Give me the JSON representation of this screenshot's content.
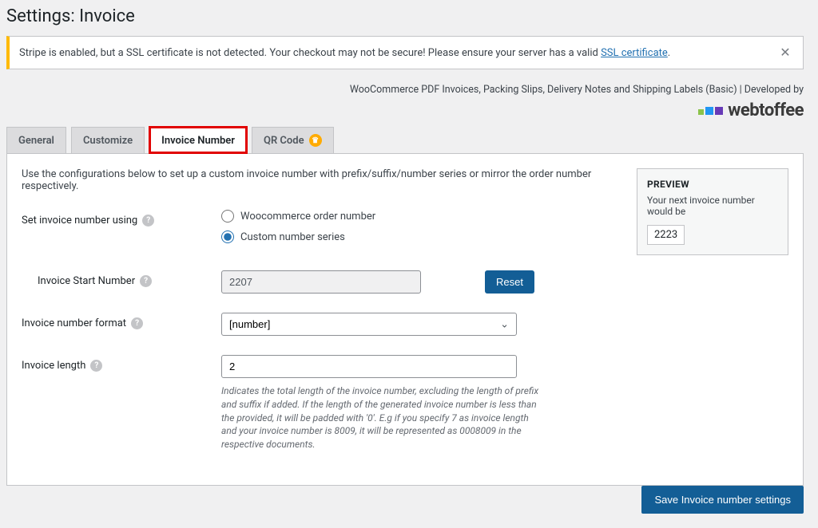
{
  "page_title": "Settings: Invoice",
  "notice": {
    "text_before": "Stripe is enabled, but a SSL certificate is not detected. Your checkout may not be secure! Please ensure your server has a valid ",
    "link_text": "SSL certificate",
    "text_after": "."
  },
  "dev_line": "WooCommerce PDF Invoices, Packing Slips, Delivery Notes and Shipping Labels (Basic) | Developed by",
  "logo_text": "webtoffee",
  "tabs": {
    "general": "General",
    "customize": "Customize",
    "invoice_number": "Invoice Number",
    "qr_code": "QR Code"
  },
  "intro": "Use the configurations below to set up a custom invoice number with prefix/suffix/number series or mirror the order number respectively.",
  "labels": {
    "set_using": "Set invoice number using",
    "start_number": "Invoice Start Number",
    "format": "Invoice number format",
    "length": "Invoice length"
  },
  "radios": {
    "woo": "Woocommerce order number",
    "custom": "Custom number series"
  },
  "start_number_value": "2207",
  "reset_label": "Reset",
  "format_value": "[number]",
  "length_value": "2",
  "length_help": "Indicates the total length of the invoice number, excluding the length of prefix and suffix if added. If the length of the generated invoice number is less than the provided, it will be padded with '0'. E.g if you specify 7 as invoice length and your invoice number is 8009, it will be represented as 0008009 in the respective documents.",
  "preview": {
    "title": "PREVIEW",
    "desc": "Your next invoice number would be",
    "value": "2223"
  },
  "save_label": "Save Invoice number settings"
}
